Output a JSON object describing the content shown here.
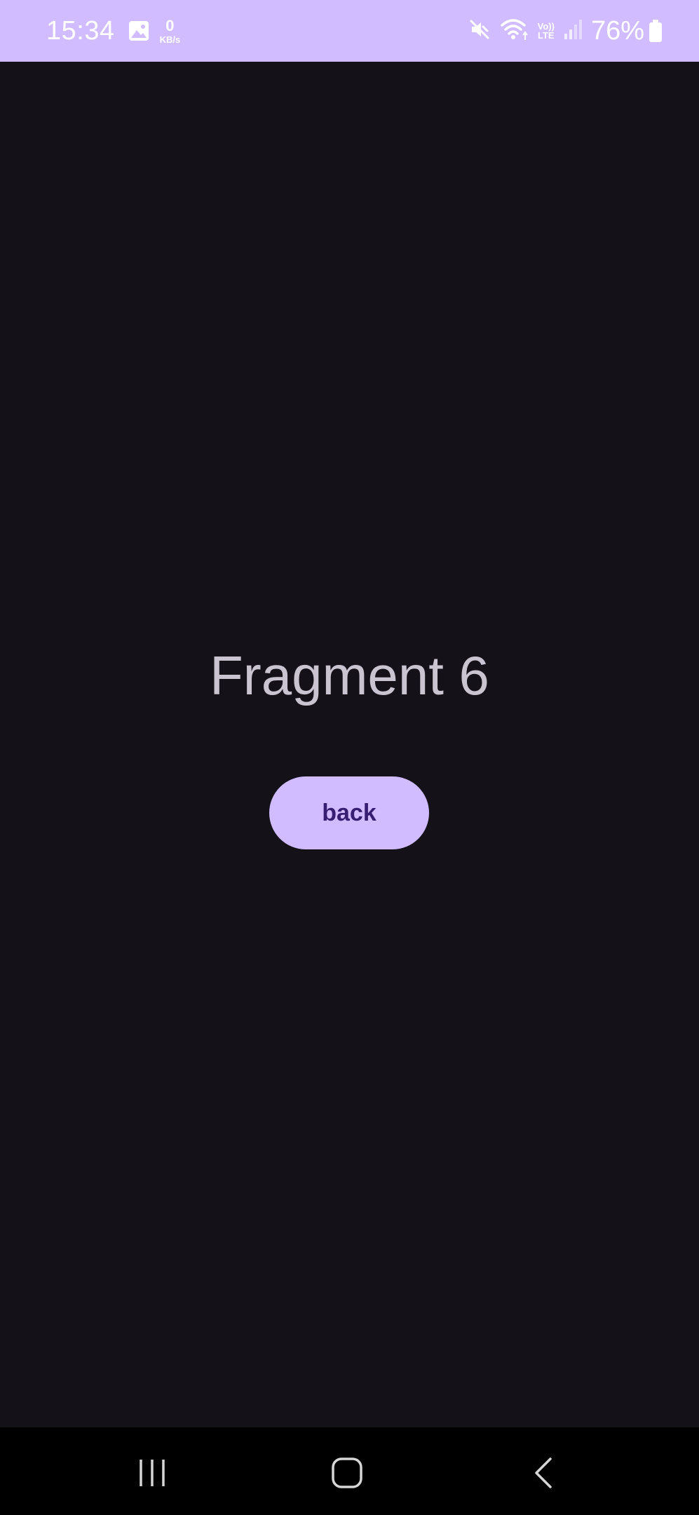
{
  "status_bar": {
    "time": "15:34",
    "net_speed_value": "0",
    "net_speed_unit": "KB/s",
    "volte_top": "Vo))",
    "volte_bottom": "LTE",
    "battery_percent": "76%",
    "icons": [
      "gallery-icon",
      "mute-icon",
      "wifi-icon",
      "volte-icon",
      "signal-icon",
      "battery-icon"
    ]
  },
  "main": {
    "title": "Fragment 6",
    "back_button_label": "back"
  },
  "nav_bar": {
    "buttons": [
      "recents-icon",
      "home-icon",
      "back-nav-icon"
    ]
  },
  "colors": {
    "status_bar_bg": "#d0bcff",
    "background": "#141218",
    "title_text": "#cac4d0",
    "button_bg": "#d0bcff",
    "button_text": "#381e72",
    "nav_bar_bg": "#000000"
  }
}
